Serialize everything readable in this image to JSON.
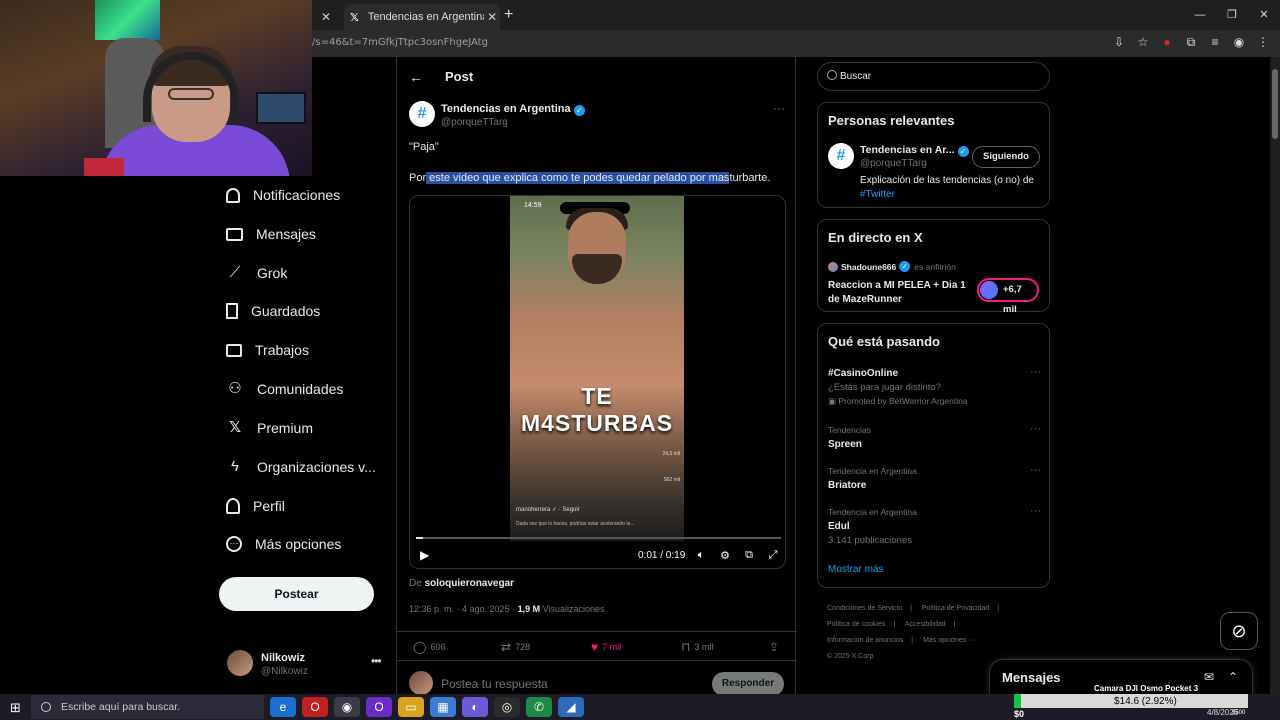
{
  "browser": {
    "tab_title": "Tendencias en Argentina en X:",
    "tab_favicon": "x-logo-icon",
    "url": "/s=46&t=7mGfkjTtpc3osnFhgeJAtg"
  },
  "nav": {
    "items": [
      {
        "label": "Notificaciones",
        "icon": "bell-icon"
      },
      {
        "label": "Mensajes",
        "icon": "mail-icon"
      },
      {
        "label": "Grok",
        "icon": "grok-icon"
      },
      {
        "label": "Guardados",
        "icon": "bookmark-icon"
      },
      {
        "label": "Trabajos",
        "icon": "briefcase-icon"
      },
      {
        "label": "Comunidades",
        "icon": "people-icon"
      },
      {
        "label": "Premium",
        "icon": "x-logo-icon"
      },
      {
        "label": "Organizaciones v...",
        "icon": "lightning-icon"
      },
      {
        "label": "Perfil",
        "icon": "person-icon"
      },
      {
        "label": "Más opciones",
        "icon": "more-circle-icon"
      }
    ],
    "post_button": "Postear",
    "account": {
      "name": "Nilkowiz",
      "handle": "@Nilkowiz"
    }
  },
  "post": {
    "header": "Post",
    "author": {
      "name": "Tendencias en Argentina",
      "handle": "@porqueTTarg"
    },
    "text_line1": "\"Paja\"",
    "text_pre": "Por",
    "text_selected": " este video que explica como te podes quedar pelado por mas",
    "text_post": "turbarte.",
    "video": {
      "phone_time": "14:59",
      "caption": "TE M4STURBAS",
      "overlay_user": "manoherrera ✓ · Seguir",
      "overlay_desc": "Dada vez que lo haces, podrías estar acelerando te...",
      "likes": "24,3 mil",
      "shares": "562 mil",
      "time": "0:01 / 0:19",
      "progress": 0.02
    },
    "source_prefix": "De",
    "source_user": "soloquieronavegar",
    "meta_time": "12:36 p. m. · 4 ago. 2025 · ",
    "meta_views": "1,9 M",
    "meta_views_label": " Visualizaciones",
    "replies": "606",
    "reposts": "728",
    "likes": "7 mil",
    "bookmarks": "3 mil",
    "reply_placeholder": "Postea tu respuesta",
    "reply_button": "Responder"
  },
  "sidebar": {
    "search_placeholder": "Buscar",
    "people": {
      "title": "Personas relevantes",
      "name": "Tendencias en Ar...",
      "handle": "@porqueTTarg",
      "follow_label": "Siguiendo",
      "bio": "Explicación de las tendencias (o no) de ",
      "bio_hashtag": "#Twitter"
    },
    "live": {
      "title": "En directo en X",
      "host": "Shadoune666",
      "host_suffix": "es anfitrión",
      "stream_title": "Reaccion a MI PELEA + Dia 1 de MazeRunner",
      "listeners": "+6,7 mil"
    },
    "trends": {
      "title": "Qué está pasando",
      "items": [
        {
          "meta": "",
          "name": "#CasinoOnline",
          "sub": "¿Estás para jugar distinto?",
          "sub2": "Promoted by BetWarrior Argentina"
        },
        {
          "meta": "Tendencias",
          "name": "Spreen",
          "sub": "",
          "sub2": ""
        },
        {
          "meta": "Tendencia en Argentina",
          "name": "Briatore",
          "sub": "",
          "sub2": ""
        },
        {
          "meta": "Tendencia en Argentina",
          "name": "Edul",
          "sub": "3.141 publicaciones",
          "sub2": ""
        }
      ],
      "show_more": "Mostrar más"
    },
    "footer": [
      "Condiciones de Servicio",
      "Política de Privacidad",
      "Política de cookies",
      "Accesibilidad",
      "Información de anuncios",
      "Más opciones ···",
      "© 2025 X Corp."
    ]
  },
  "messages_drawer": {
    "title": "Mensajes"
  },
  "taskbar": {
    "search_placeholder": "Escribe aquí para buscar.",
    "overlay_label": "Camara DJI Osmo Pocket 3",
    "price_text": "$14.6 (2.92%)",
    "price_progress": 0.0292,
    "price_min": "$0",
    "price_max": "$500",
    "date": "4/8/2025"
  }
}
